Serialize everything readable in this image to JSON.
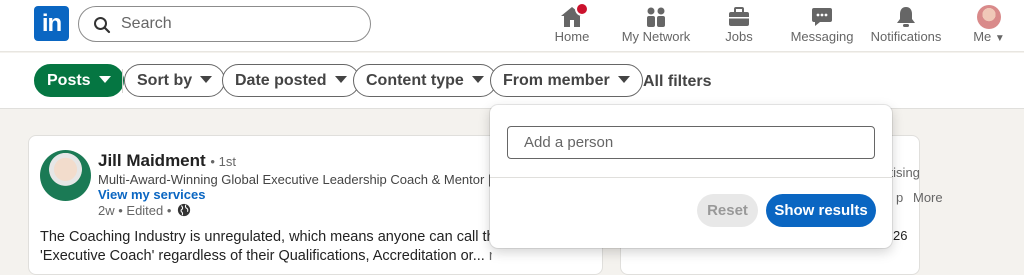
{
  "header": {
    "logo_text": "in",
    "search": {
      "placeholder": "Search"
    },
    "nav": [
      {
        "label": "Home",
        "icon": "home-icon",
        "has_badge": true
      },
      {
        "label": "My Network",
        "icon": "network-icon"
      },
      {
        "label": "Jobs",
        "icon": "briefcase-icon"
      },
      {
        "label": "Messaging",
        "icon": "messaging-icon"
      },
      {
        "label": "Notifications",
        "icon": "bell-icon"
      },
      {
        "label": "Me",
        "icon": "avatar"
      }
    ]
  },
  "filters": {
    "posts": "Posts",
    "sort_by": "Sort by",
    "date_posted": "Date posted",
    "content_type": "Content type",
    "from_member": "From member",
    "all_filters": "All filters"
  },
  "post": {
    "author": "Jill Maidment",
    "degree": "• 1st",
    "headline": "Multi-Award-Winning Global Executive Leadership Coach & Mentor | C",
    "services_link": "View my services",
    "meta": "2w • Edited •",
    "body_line1": "The Coaching Industry is unregulated, which means anyone can call th",
    "body_line2": "'Executive Coach' regardless of their Qualifications, Accreditation or...",
    "more_label": "more"
  },
  "sidebar": {
    "frag1": "r",
    "frag2": "ertising",
    "frag3": "p",
    "more": "More",
    "frag4": "26"
  },
  "popup": {
    "add_person_placeholder": "Add a person",
    "reset_label": "Reset",
    "show_results_label": "Show results"
  },
  "colors": {
    "brand_blue": "#0a66c2",
    "active_green": "#057642",
    "badge_red": "#cb112d"
  }
}
